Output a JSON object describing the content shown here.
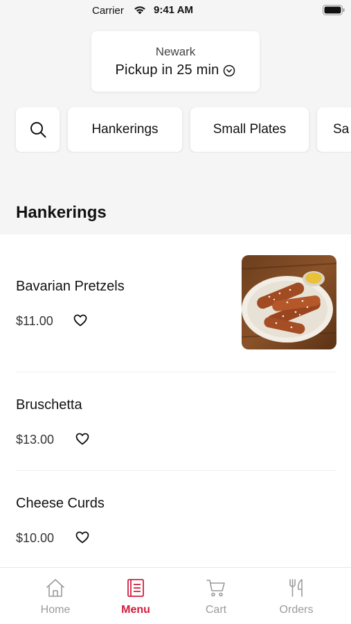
{
  "status_bar": {
    "carrier": "Carrier",
    "time": "9:41 AM"
  },
  "location": {
    "city": "Newark",
    "pickup": "Pickup in 25 min"
  },
  "categories": [
    "Hankerings",
    "Small Plates",
    "Sa"
  ],
  "section": {
    "title": "Hankerings"
  },
  "items": [
    {
      "name": "Bavarian Pretzels",
      "price": "$11.00"
    },
    {
      "name": "Bruschetta",
      "price": "$13.00"
    },
    {
      "name": "Cheese Curds",
      "price": "$10.00"
    }
  ],
  "nav": [
    {
      "label": "Home",
      "icon": "home-icon"
    },
    {
      "label": "Menu",
      "icon": "menu-icon",
      "active": true
    },
    {
      "label": "Cart",
      "icon": "cart-icon"
    },
    {
      "label": "Orders",
      "icon": "orders-icon"
    }
  ],
  "colors": {
    "accent": "#d11d3f",
    "inactive": "#9a9a9a",
    "background": "#f5f5f5"
  }
}
